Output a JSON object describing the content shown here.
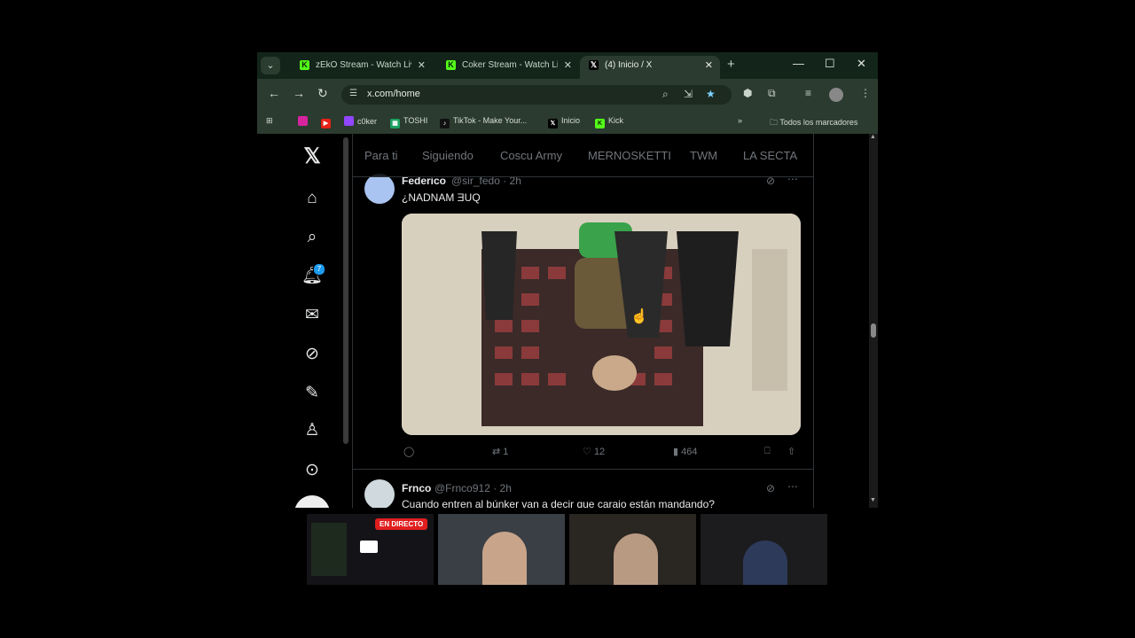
{
  "browser": {
    "tabs": [
      {
        "label": "zEkO Stream - Watch Live",
        "favicon": "kick-icon"
      },
      {
        "label": "Coker Stream - Watch Live",
        "favicon": "kick-icon"
      },
      {
        "label": "(4) Inicio / X",
        "favicon": "x-logo-icon"
      }
    ],
    "url": "x.com/home",
    "bookmarks": [
      {
        "label": "",
        "icon": "instagram-icon"
      },
      {
        "label": "",
        "icon": "youtube-icon"
      },
      {
        "label": "c0ker",
        "icon": "twitch-icon"
      },
      {
        "label": "TOSHI",
        "icon": "sheets-icon"
      },
      {
        "label": "TikTok - Make Your...",
        "icon": "tiktok-icon"
      },
      {
        "label": "Inicio",
        "icon": "x-logo-icon"
      },
      {
        "label": "Kick",
        "icon": "kick-icon"
      }
    ],
    "all_bookmarks": "Todos los marcadores",
    "more_bookmarks": "»"
  },
  "x": {
    "notification_count": "7",
    "timeline_tabs": [
      "Para ti",
      "Siguiendo",
      "Coscu Army",
      "MERNOSKETTI",
      "TWM",
      "LA SECTA"
    ],
    "tweets": [
      {
        "name": "Federico",
        "handle": "@sir_fedo · 2h",
        "text": "¿NADNAM ƎUQ",
        "stats": {
          "reply": "",
          "retweet": "1",
          "like": "12",
          "views": "464"
        }
      },
      {
        "name": "Frnco",
        "handle": "@Frnco912 · 2h",
        "text": "Cuando entren al búnker van a decir que carajo están mandando?"
      }
    ]
  },
  "stream": {
    "live_label": "EN DIRECTO"
  },
  "colors": {
    "accent": "#1d9bf0",
    "chrome_tabbar": "#13251a",
    "chrome_toolbar": "#2b3b2f",
    "kick": "#53fc18"
  }
}
